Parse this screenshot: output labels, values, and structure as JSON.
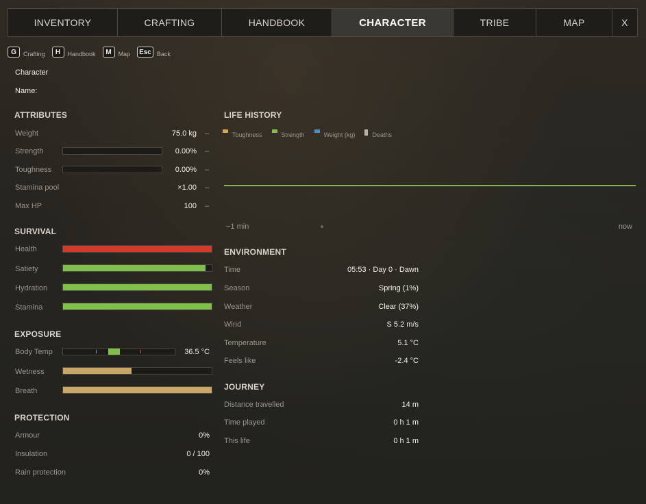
{
  "tabs": [
    {
      "label": "INVENTORY",
      "active": false
    },
    {
      "label": "CRAFTING",
      "active": false
    },
    {
      "label": "HANDBOOK",
      "active": false
    },
    {
      "label": "CHARACTER",
      "active": true
    },
    {
      "label": "TRIBE",
      "active": false
    },
    {
      "label": "MAP",
      "active": false
    },
    {
      "label": "X",
      "active": false
    }
  ],
  "hotkeys": [
    {
      "key": "G",
      "label": "Crafting"
    },
    {
      "key": "H",
      "label": "Handbook"
    },
    {
      "key": "M",
      "label": "Map"
    },
    {
      "key": "Esc",
      "label": "Back"
    }
  ],
  "character": {
    "heading": "Character",
    "name_label": "Name:"
  },
  "attributes": {
    "title": "ATTRIBUTES",
    "weight": {
      "label": "Weight",
      "value": "75.0 kg",
      "dash": "–"
    },
    "strength": {
      "label": "Strength",
      "value": "0.00%",
      "dash": "–",
      "fraction": 0
    },
    "toughness": {
      "label": "Toughness",
      "value": "0.00%",
      "dash": "–",
      "fraction": 0
    },
    "stamina_pool": {
      "label": "Stamina pool",
      "value": "×1.00",
      "dash": "–"
    },
    "max_hp": {
      "label": "Max HP",
      "value": "100",
      "dash": "–"
    }
  },
  "survival": {
    "title": "SURVIVAL",
    "bars": [
      {
        "label": "Health",
        "fraction": 1.0,
        "color": "#d43a2a"
      },
      {
        "label": "Satiety",
        "fraction": 0.96,
        "color": "#7fbf4a"
      },
      {
        "label": "Hydration",
        "fraction": 1.0,
        "color": "#7fbf4a"
      },
      {
        "label": "Stamina",
        "fraction": 1.0,
        "color": "#7fbf4a"
      }
    ]
  },
  "exposure": {
    "title": "EXPOSURE",
    "body_temp": {
      "label": "Body Temp",
      "value": "36.5 °C"
    },
    "wetness": {
      "label": "Wetness",
      "fraction": 0.46,
      "color": "#c9a767"
    },
    "breath": {
      "label": "Breath",
      "fraction": 1.0,
      "color": "#c9a767"
    }
  },
  "protection": {
    "title": "PROTECTION",
    "armour": {
      "label": "Armour",
      "value": "0%"
    },
    "insulation": {
      "label": "Insulation",
      "value": "0 / 100"
    },
    "rain": {
      "label": "Rain protection",
      "value": "0%"
    }
  },
  "life_history": {
    "title": "LIFE HISTORY",
    "legend": [
      {
        "label": "Toughness",
        "color": "#d9a653"
      },
      {
        "label": "Strength",
        "color": "#7fbf4a"
      },
      {
        "label": "Weight (kg)",
        "color": "#4a90c8"
      },
      {
        "label": "Deaths",
        "color": "#b8b2a0"
      }
    ],
    "x_start": "−1 min",
    "x_end": "now",
    "line_color": "#86b24f"
  },
  "environment": {
    "title": "ENVIRONMENT",
    "rows": [
      {
        "label": "Time",
        "value": "05:53 · Day 0 · Dawn"
      },
      {
        "label": "Season",
        "value": "Spring (1%)"
      },
      {
        "label": "Weather",
        "value": "Clear (37%)"
      },
      {
        "label": "Wind",
        "value": "S 5.2 m/s"
      },
      {
        "label": "Temperature",
        "value": "5.1 °C"
      },
      {
        "label": "Feels like",
        "value": "-2.4 °C"
      }
    ]
  },
  "journey": {
    "title": "JOURNEY",
    "rows": [
      {
        "label": "Distance travelled",
        "value": "14 m"
      },
      {
        "label": "Time played",
        "value": "0 h 1 m"
      },
      {
        "label": "This life",
        "value": "0 h 1 m"
      }
    ]
  }
}
